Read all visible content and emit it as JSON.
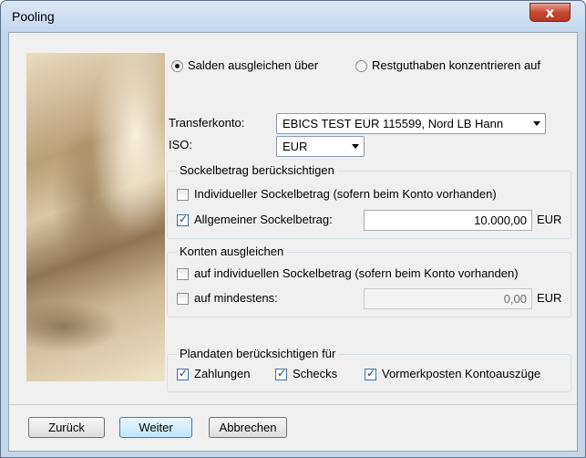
{
  "window": {
    "title": "Pooling",
    "close_symbol": "x"
  },
  "mode": {
    "option_balance_label": "Salden ausgleichen über",
    "option_concentrate_label": "Restguthaben konzentrieren auf",
    "selected": "balance"
  },
  "transfer": {
    "label": "Transferkonto:",
    "value": "EBICS TEST EUR 115599, Nord LB Hann"
  },
  "iso": {
    "label": "ISO:",
    "value": "EUR"
  },
  "base_amount": {
    "group_title": "Sockelbetrag berücksichtigen",
    "individual_label": "Individueller Sockelbetrag (sofern beim Konto vorhanden)",
    "individual_checked": false,
    "general_label": "Allgemeiner Sockelbetrag:",
    "general_checked": true,
    "general_value": "10.000,00",
    "currency": "EUR"
  },
  "balance_accounts": {
    "group_title": "Konten ausgleichen",
    "individual_label": "auf individuellen Sockelbetrag (sofern beim Konto vorhanden)",
    "individual_checked": false,
    "minimum_label": "auf mindestens:",
    "minimum_checked": false,
    "minimum_value": "0,00",
    "currency": "EUR"
  },
  "plan_data": {
    "group_title": "Plandaten berücksichtigen für",
    "payments_label": "Zahlungen",
    "payments_checked": true,
    "checks_label": "Schecks",
    "checks_checked": true,
    "memo_label": "Vormerkposten Kontoauszüge",
    "memo_checked": true
  },
  "buttons": {
    "back": "Zurück",
    "next": "Weiter",
    "cancel": "Abbrechen"
  }
}
